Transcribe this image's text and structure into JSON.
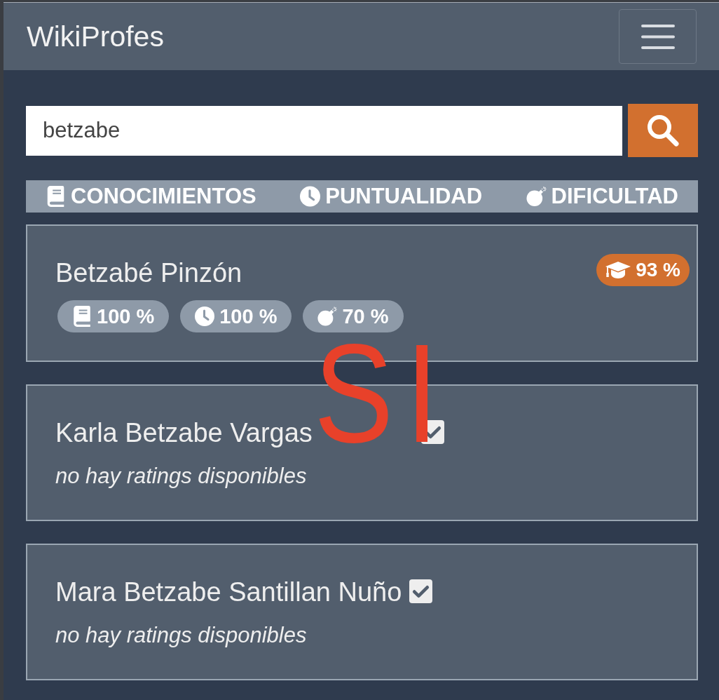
{
  "navbar": {
    "brand": "WikiProfes"
  },
  "search": {
    "value": "betzabe"
  },
  "sort_bar": [
    {
      "kind": "knowledge",
      "label": "CONOCIMIENTOS"
    },
    {
      "kind": "punctuality",
      "label": "PUNTUALIDAD"
    },
    {
      "kind": "difficulty",
      "label": "DIFICULTAD"
    }
  ],
  "results": [
    {
      "name": "Betzabé Pinzón",
      "verified": false,
      "overall": "93 %",
      "ratings": [
        {
          "kind": "knowledge",
          "value": "100 %"
        },
        {
          "kind": "punctuality",
          "value": "100 %"
        },
        {
          "kind": "difficulty",
          "value": "70 %"
        }
      ]
    },
    {
      "name": "Karla Betzabe Vargas",
      "verified": true,
      "note": "no hay ratings disponibles"
    },
    {
      "name": "Mara Betzabe Santillan Nuño",
      "verified": true,
      "note": "no hay ratings disponibles"
    }
  ],
  "annotation": {
    "text": "SI"
  }
}
